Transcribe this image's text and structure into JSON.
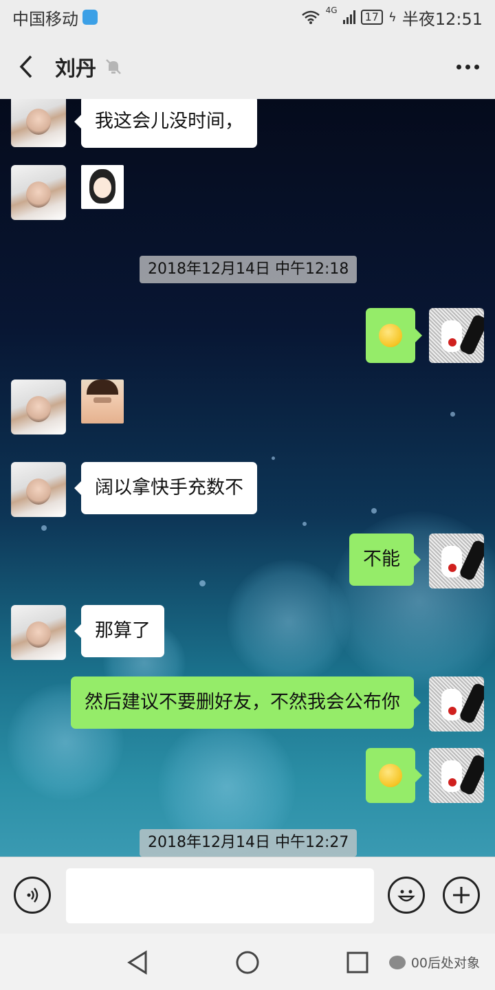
{
  "status_bar": {
    "carrier": "中国移动",
    "network": "4G",
    "battery": "17",
    "time": "半夜12:51"
  },
  "header": {
    "title": "刘丹"
  },
  "messages": [
    {
      "side": "left",
      "type": "text",
      "text": "我这会儿没时间，"
    },
    {
      "side": "left",
      "type": "sticker"
    },
    {
      "type": "timestamp",
      "text": "2018年12月14日 中午12:18"
    },
    {
      "side": "right",
      "type": "emoji",
      "emoji": "crying-laughing-emoji"
    },
    {
      "side": "left",
      "type": "sticker"
    },
    {
      "side": "left",
      "type": "text",
      "text": "阔以拿快手充数不"
    },
    {
      "side": "right",
      "type": "text",
      "text": "不能"
    },
    {
      "side": "left",
      "type": "text",
      "text": "那算了"
    },
    {
      "side": "right",
      "type": "text",
      "text": "然后建议不要删好友，不然我会公布你"
    },
    {
      "side": "right",
      "type": "emoji",
      "emoji": "confused-emoji"
    },
    {
      "type": "timestamp",
      "text": "2018年12月14日 中午12:27"
    }
  ],
  "input": {
    "placeholder": ""
  },
  "watermark": "00后处对象",
  "colors": {
    "sent_bubble": "#95ec69",
    "received_bubble": "#ffffff",
    "bar_bg": "#ededed"
  }
}
